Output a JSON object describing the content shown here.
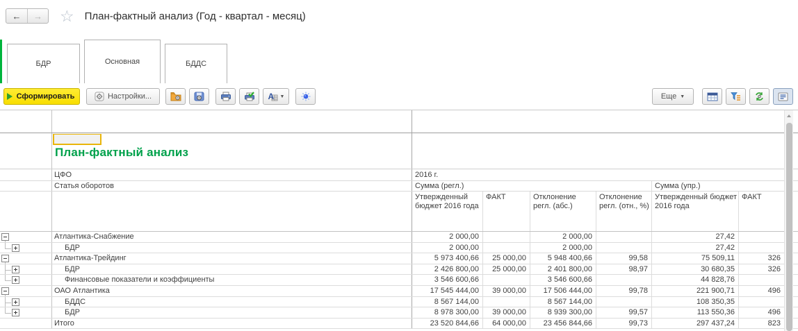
{
  "colors": {
    "accent_green": "#00b43c",
    "report_title_green": "#00a14b",
    "generate_button_yellow": "#f8de00",
    "selected_cell_border": "#e9b50a"
  },
  "icons": {
    "back": "←",
    "forward": "→",
    "star": "☆",
    "dropdown": "▼"
  },
  "header": {
    "title": "План-фактный анализ (Год - квартал - месяц)"
  },
  "tabs": [
    {
      "label": "БДР",
      "active": false
    },
    {
      "label": "Основная",
      "active": true
    },
    {
      "label": "БДДС",
      "active": false
    }
  ],
  "toolbar": {
    "generate_label": "Сформировать",
    "settings_label": "Настройки...",
    "font_label": "A",
    "more_label": "Еще"
  },
  "report": {
    "title": "План-фактный анализ",
    "row_header_1": "ЦФО",
    "row_header_2": "Статья оборотов",
    "col_group_year": "2016 г.",
    "col_group_regl": "Сумма (регл.)",
    "col_group_upr": "Сумма (упр.)",
    "columns": [
      "Утвержденный бюджет 2016 года",
      "ФАКТ",
      "Отклонение регл. (абс.)",
      "Отклонение регл. (отн., %)",
      "Утвержденный бюджет 2016  года",
      "ФАКТ"
    ],
    "rows": [
      {
        "level": 1,
        "toggle": "minus",
        "connector": "down",
        "label": "Атлантика-Снабжение",
        "values": [
          "2 000,00",
          "",
          "2 000,00",
          "",
          "27,42",
          ""
        ]
      },
      {
        "level": 2,
        "toggle": "plus",
        "connector": "ell",
        "label": "БДР",
        "values": [
          "2 000,00",
          "",
          "2 000,00",
          "",
          "27,42",
          ""
        ]
      },
      {
        "level": 1,
        "toggle": "minus",
        "connector": "down",
        "label": "Атлантика-Трейдинг",
        "values": [
          "5 973 400,66",
          "25 000,00",
          "5 948 400,66",
          "99,58",
          "75 509,11",
          "326"
        ]
      },
      {
        "level": 2,
        "toggle": "plus",
        "connector": "tee",
        "label": "БДР",
        "values": [
          "2 426 800,00",
          "25 000,00",
          "2 401 800,00",
          "98,97",
          "30 680,35",
          "326"
        ]
      },
      {
        "level": 2,
        "toggle": "plus",
        "connector": "ell",
        "label": "Финансовые показатели и коэффициенты",
        "values": [
          "3 546 600,66",
          "",
          "3 546 600,66",
          "",
          "44 828,76",
          ""
        ]
      },
      {
        "level": 1,
        "toggle": "minus",
        "connector": "down",
        "label": "ОАО Атлантика",
        "values": [
          "17 545 444,00",
          "39 000,00",
          "17 506 444,00",
          "99,78",
          "221 900,71",
          "496"
        ]
      },
      {
        "level": 2,
        "toggle": "plus",
        "connector": "tee",
        "label": "БДДС",
        "values": [
          "8 567 144,00",
          "",
          "8 567 144,00",
          "",
          "108 350,35",
          ""
        ]
      },
      {
        "level": 2,
        "toggle": "plus",
        "connector": "ell",
        "label": "БДР",
        "values": [
          "8 978 300,00",
          "39 000,00",
          "8 939 300,00",
          "99,57",
          "113 550,36",
          "496"
        ]
      },
      {
        "level": 0,
        "toggle": "none",
        "connector": "none",
        "label": "Итого",
        "values": [
          "23 520 844,66",
          "64 000,00",
          "23 456 844,66",
          "99,73",
          "297 437,24",
          "823"
        ]
      }
    ]
  }
}
